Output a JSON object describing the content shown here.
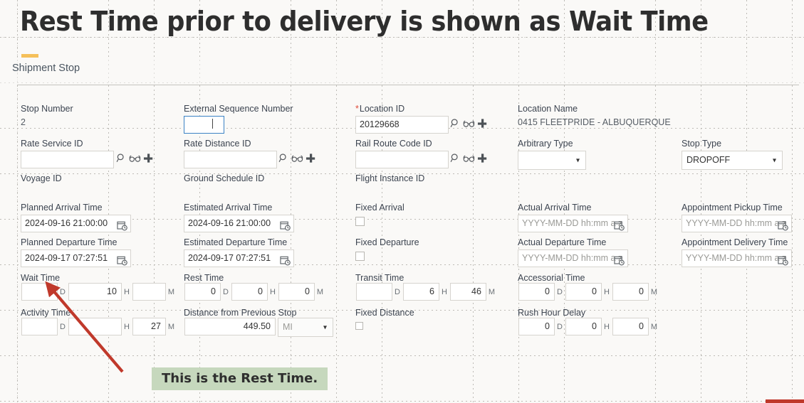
{
  "slide": {
    "title": "Rest Time prior to delivery is shown as Wait Time",
    "accent_color": "#f5c05a",
    "background_color": "#faf9f7"
  },
  "section": {
    "title": "Shipment Stop"
  },
  "annotations": {
    "callout_text": "This is the Rest Time.",
    "callout_bg": "#c6d8bd",
    "arrow_color": "#c0392b",
    "arrow_points_to": "Wait Time"
  },
  "icons": {
    "search": "search-icon",
    "view": "glasses-icon",
    "add": "plus-icon",
    "calendar": "calendar-clock-icon",
    "chevron": "⌄"
  },
  "form": {
    "row1": {
      "stop_number": {
        "label": "Stop Number",
        "value": "2"
      },
      "external_sequence_number": {
        "label": "External Sequence Number",
        "value": "",
        "focused": true
      },
      "location_id": {
        "label": "Location ID",
        "required": true,
        "value": "20129668"
      },
      "location_name": {
        "label": "Location Name",
        "value": "0415 FLEETPRIDE - ALBUQUERQUE"
      }
    },
    "row2": {
      "rate_service_id": {
        "label": "Rate Service ID",
        "value": ""
      },
      "rate_distance_id": {
        "label": "Rate Distance ID",
        "value": ""
      },
      "rail_route_code_id": {
        "label": "Rail Route Code ID",
        "value": ""
      },
      "arbitrary_type": {
        "label": "Arbitrary Type",
        "value": ""
      },
      "stop_type": {
        "label": "Stop Type",
        "value": "DROPOFF"
      }
    },
    "row3": {
      "voyage_id": {
        "label": "Voyage ID"
      },
      "ground_schedule_id": {
        "label": "Ground Schedule ID"
      },
      "flight_instance_id": {
        "label": "Flight Instance ID"
      }
    },
    "row4": {
      "planned_arrival_time": {
        "label": "Planned Arrival Time",
        "value": "2024-09-16 21:00:00"
      },
      "estimated_arrival_time": {
        "label": "Estimated Arrival Time",
        "value": "2024-09-16 21:00:00"
      },
      "fixed_arrival": {
        "label": "Fixed Arrival",
        "checked": false
      },
      "actual_arrival_time": {
        "label": "Actual Arrival Time",
        "value": "",
        "placeholder": "YYYY-MM-DD hh:mm a z"
      },
      "appointment_pickup_time": {
        "label": "Appointment Pickup Time",
        "value": "",
        "placeholder": "YYYY-MM-DD hh:mm a z"
      }
    },
    "row5": {
      "planned_departure_time": {
        "label": "Planned Departure Time",
        "value": "2024-09-17 07:27:51"
      },
      "estimated_departure_time": {
        "label": "Estimated Departure Time",
        "value": "2024-09-17 07:27:51"
      },
      "fixed_departure": {
        "label": "Fixed Departure",
        "checked": false
      },
      "actual_departure_time": {
        "label": "Actual Departure Time",
        "value": "",
        "placeholder": "YYYY-MM-DD hh:mm a z"
      },
      "appointment_delivery_time": {
        "label": "Appointment Delivery Time",
        "value": "",
        "placeholder": "YYYY-MM-DD hh:mm a z"
      }
    },
    "row6": {
      "wait_time": {
        "label": "Wait Time",
        "d": "",
        "h": "10",
        "m": ""
      },
      "rest_time": {
        "label": "Rest Time",
        "d": "0",
        "h": "0",
        "m": "0"
      },
      "transit_time": {
        "label": "Transit Time",
        "d": "",
        "h": "6",
        "m": "46"
      },
      "accessorial_time": {
        "label": "Accessorial Time",
        "d": "0",
        "h": "0",
        "m": "0"
      }
    },
    "row7": {
      "activity_time": {
        "label": "Activity Time",
        "d": "",
        "h": "",
        "m": "27"
      },
      "distance_from_previous_stop": {
        "label": "Distance from Previous Stop",
        "value": "449.50",
        "unit": "MI"
      },
      "fixed_distance": {
        "label": "Fixed Distance",
        "checked": false
      },
      "rush_hour_delay": {
        "label": "Rush Hour Delay",
        "d": "0",
        "h": "0",
        "m": "0"
      }
    },
    "units": {
      "d": "D",
      "h": "H",
      "m": "M"
    }
  }
}
